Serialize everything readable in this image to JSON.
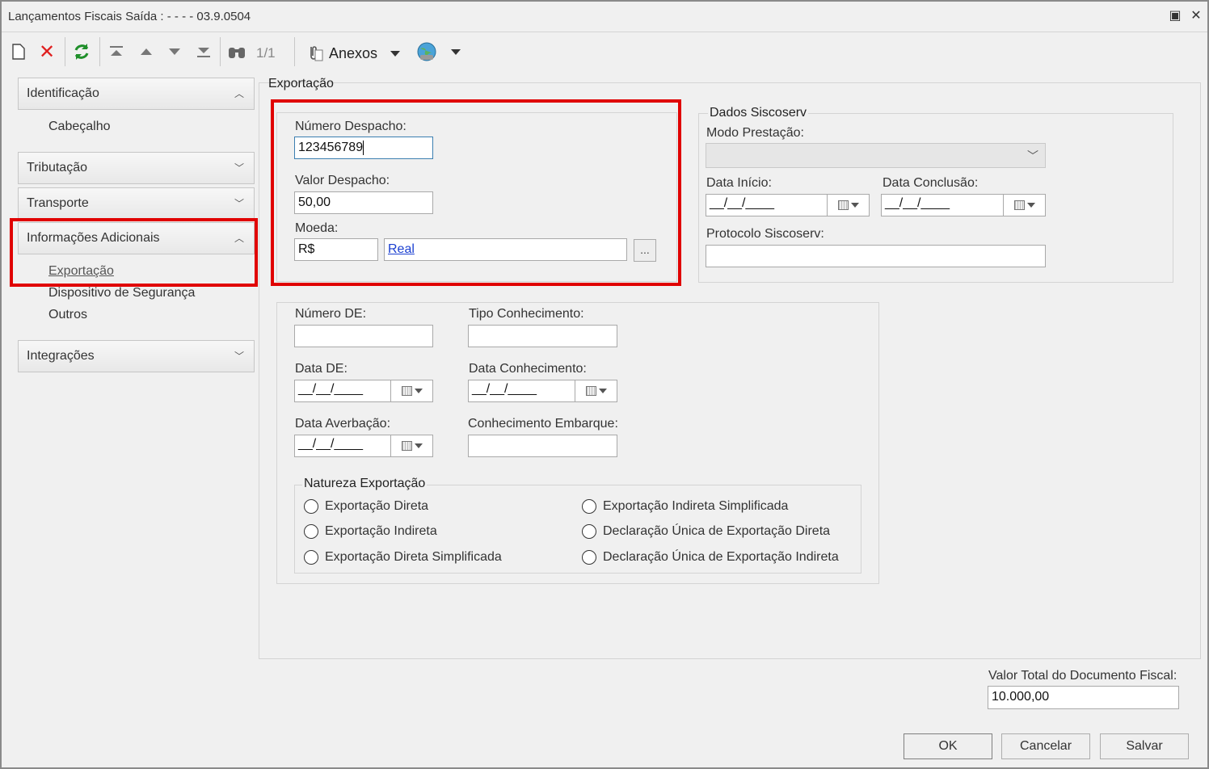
{
  "window": {
    "title": "Lançamentos Fiscais Saída : - - - - 03.9.0504"
  },
  "toolbar": {
    "counter": "1/1",
    "anexos_label": "Anexos",
    "icons": [
      "new-document-icon",
      "delete-icon",
      "refresh-icon",
      "first-record-icon",
      "previous-record-icon",
      "next-record-icon",
      "last-record-icon",
      "search-binoculars-icon",
      "attachment-icon",
      "globe-icon"
    ]
  },
  "sidebar": {
    "groups": [
      {
        "label": "Identificação",
        "expanded": true,
        "items": [
          "Cabeçalho"
        ]
      },
      {
        "label": "Tributação",
        "expanded": false,
        "items": []
      },
      {
        "label": "Transporte",
        "expanded": false,
        "items": []
      },
      {
        "label": "Informações Adicionais",
        "expanded": true,
        "items": [
          "Exportação",
          "Dispositivo de Segurança",
          "Outros"
        ]
      },
      {
        "label": "Integrações",
        "expanded": false,
        "items": []
      }
    ],
    "selected_item": "Exportação"
  },
  "export": {
    "section_title": "Exportação",
    "numero_despacho_label": "Número Despacho:",
    "numero_despacho_value": "123456789",
    "valor_despacho_label": "Valor Despacho:",
    "valor_despacho_value": "50,00",
    "moeda_label": "Moeda:",
    "moeda_code": "R$",
    "moeda_name": "Real",
    "moeda_lookup": "...",
    "numero_de_label": "Número DE:",
    "tipo_conhecimento_label": "Tipo Conhecimento:",
    "data_de_label": "Data DE:",
    "data_de_value": "__/__/____",
    "data_conhecimento_label": "Data Conhecimento:",
    "data_conhecimento_value": "__/__/____",
    "data_averbacao_label": "Data Averbação:",
    "data_averbacao_value": "__/__/____",
    "conhecimento_embarque_label": "Conhecimento Embarque:",
    "natureza_title": "Natureza Exportação",
    "natureza_options": [
      "Exportação Direta",
      "Exportação Indireta",
      "Exportação Direta Simplificada",
      "Exportação Indireta Simplificada",
      "Declaração Única de Exportação Direta",
      "Declaração Única de Exportação Indireta"
    ]
  },
  "siscoserv": {
    "title": "Dados Siscoserv",
    "modo_prestacao_label": "Modo Prestação:",
    "data_inicio_label": "Data Início:",
    "data_inicio_value": "__/__/____",
    "data_conclusao_label": "Data Conclusão:",
    "data_conclusao_value": "__/__/____",
    "protocolo_label": "Protocolo Siscoserv:"
  },
  "footer": {
    "valor_total_label": "Valor Total do Documento Fiscal:",
    "valor_total_value": "10.000,00",
    "ok_label": "OK",
    "cancelar_label": "Cancelar",
    "salvar_label": "Salvar"
  },
  "colors": {
    "highlight": "#e00000",
    "link": "#1a3fd1"
  }
}
